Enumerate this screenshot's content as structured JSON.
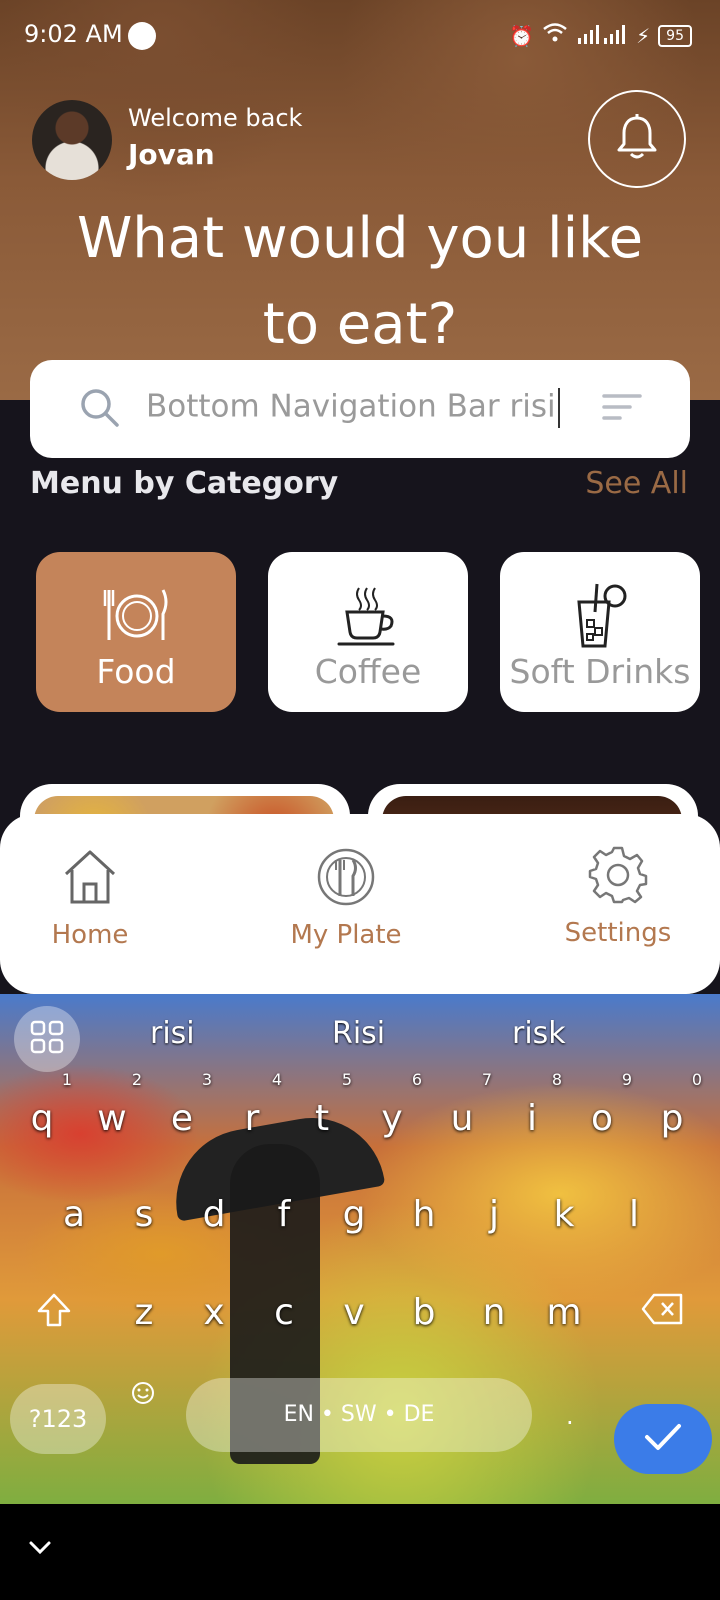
{
  "status": {
    "time": "9:02 AM",
    "battery": "95"
  },
  "header": {
    "welcome": "Welcome back",
    "user_name": "Jovan",
    "headline_1": "What would you like",
    "headline_2": "to eat?"
  },
  "search": {
    "value": "Bottom Navigation Bar risi"
  },
  "categories": {
    "title": "Menu by Category",
    "see_all": "See All",
    "items": [
      {
        "label": "Food",
        "icon": "dinner-plate-icon",
        "active": true
      },
      {
        "label": "Coffee",
        "icon": "coffee-cup-icon",
        "active": false
      },
      {
        "label": "Soft Drinks",
        "icon": "soft-drink-icon",
        "active": false
      }
    ]
  },
  "bottom_nav": {
    "items": [
      {
        "label": "Home",
        "icon": "home-icon"
      },
      {
        "label": "My Plate",
        "icon": "plate-icon"
      },
      {
        "label": "Settings",
        "icon": "gear-icon"
      }
    ]
  },
  "keyboard": {
    "suggestions": [
      "risi",
      "Risi",
      "risk"
    ],
    "row1": [
      "q",
      "w",
      "e",
      "r",
      "t",
      "y",
      "u",
      "i",
      "o",
      "p"
    ],
    "row1_nums": [
      "1",
      "2",
      "3",
      "4",
      "5",
      "6",
      "7",
      "8",
      "9",
      "0"
    ],
    "row2": [
      "a",
      "s",
      "d",
      "f",
      "g",
      "h",
      "j",
      "k",
      "l"
    ],
    "row3": [
      "z",
      "x",
      "c",
      "v",
      "b",
      "n",
      "m"
    ],
    "symbols": "?123",
    "space": "EN • SW • DE",
    "period": "."
  },
  "colors": {
    "accent": "#c4845a",
    "accent_text": "#b3784f",
    "background": "#16141c",
    "enter": "#3b7ce8"
  }
}
